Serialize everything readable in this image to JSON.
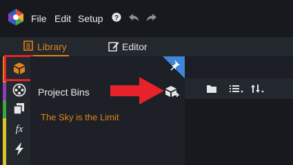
{
  "menu": {
    "items": [
      {
        "label": "File"
      },
      {
        "label": "Edit"
      },
      {
        "label": "Setup"
      }
    ]
  },
  "tabs": {
    "library": {
      "label": "Library"
    },
    "editor": {
      "label": "Editor"
    }
  },
  "bins": {
    "title": "Project Bins",
    "items": [
      "The Sky is the Limit"
    ]
  },
  "colors": {
    "accent": "#e08418",
    "highlight": "#e8222a",
    "pin": "#3e86d6",
    "rail_strips": [
      "#e08418",
      "#8a3fb3",
      "#3ca63c",
      "#d9c22a"
    ]
  },
  "icons": {
    "library_tab": "library-book-icon",
    "editor_tab": "edit-pencil-icon",
    "rail": [
      "library-box-icon",
      "media-reel-icon",
      "copy-pages-icon",
      "fx-icon",
      "lightning-icon"
    ],
    "bins": [
      "new-bin-icon",
      "pin-icon"
    ],
    "toolbar": [
      "folder-icon",
      "list-view-icon",
      "sort-icon"
    ]
  }
}
